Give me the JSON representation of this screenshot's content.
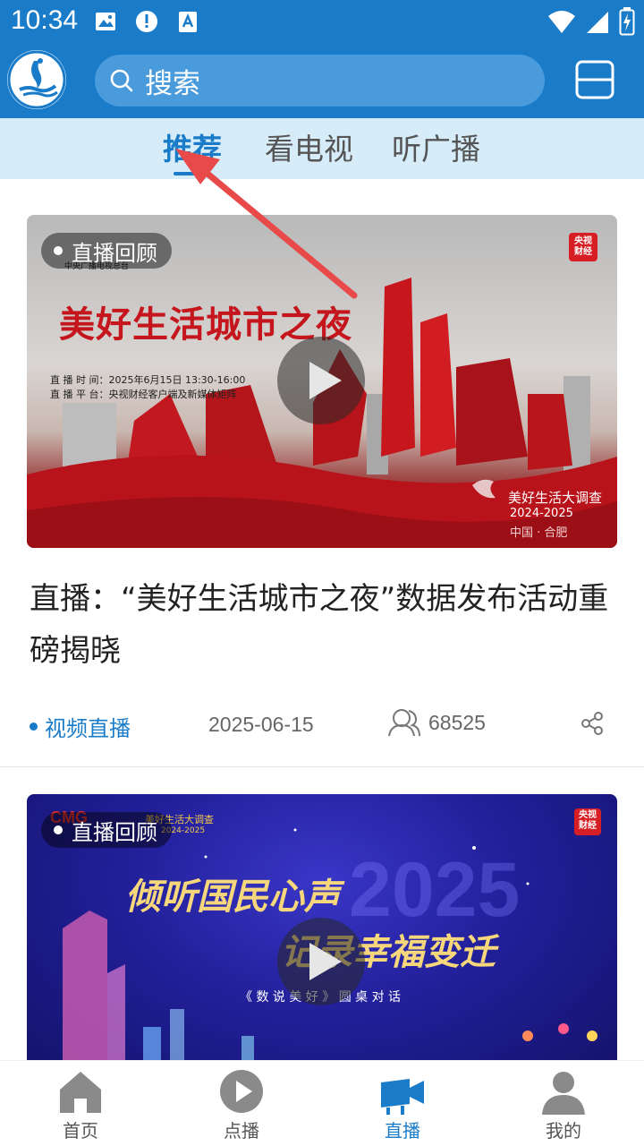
{
  "status_bar": {
    "time": "10:34"
  },
  "header": {
    "search_placeholder": "搜索"
  },
  "tabs": [
    {
      "label": "推荐",
      "active": true
    },
    {
      "label": "看电视",
      "active": false
    },
    {
      "label": "听广播",
      "active": false
    }
  ],
  "feed": [
    {
      "badge": "直播回顾",
      "thumb_text": {
        "org": "中央广播电视总台",
        "headline": "美好生活城市之夜",
        "time_line": "直 播 时 间：2025年6月15日 13:30-16:00",
        "platform_line": "直 播 平 台：央视财经客户端及新媒体矩阵",
        "channel_logo": "央视财经",
        "survey": "美好生活大调查",
        "years": "2024-2025",
        "location": "中国 · 合肥"
      },
      "title": "直播：“美好生活城市之夜”数据发布活动重磅揭晓",
      "category": "视频直播",
      "date": "2025-06-15",
      "views": "68525"
    },
    {
      "badge": "直播回顾",
      "thumb_text": {
        "brand": "CMG",
        "survey": "美好生活大调查",
        "years": "2024-2025",
        "channel_logo": "央视财经",
        "line1": "倾听国民心声",
        "line2": "记录幸福变迁",
        "subtitle": "《 数 说 美 好 》 圆 桌 对 话",
        "big_year": "2025"
      }
    }
  ],
  "bottom_nav": [
    {
      "label": "首页",
      "icon": "home-icon",
      "active": false
    },
    {
      "label": "点播",
      "icon": "play-circle-icon",
      "active": false
    },
    {
      "label": "直播",
      "icon": "video-camera-icon",
      "active": true
    },
    {
      "label": "我的",
      "icon": "user-icon",
      "active": false
    }
  ],
  "colors": {
    "primary": "#1a7cc9",
    "tab_bg": "#d6ecf8",
    "annotation_arrow": "#e84a4a"
  }
}
